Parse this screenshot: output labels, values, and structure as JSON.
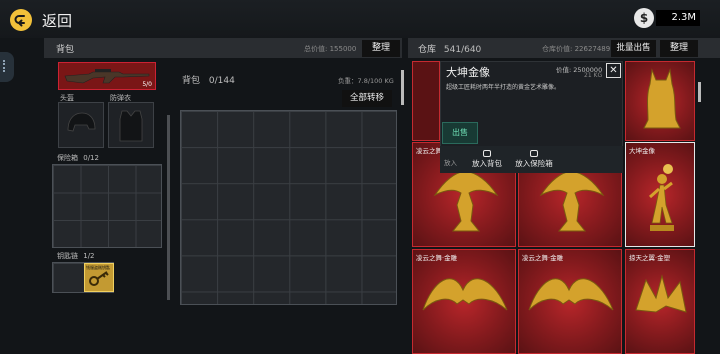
{
  "top": {
    "back_label": "返回",
    "currency": "2.3M",
    "coin_glyph": "$"
  },
  "backpack_panel": {
    "title": "背包",
    "total_value_label": "总价值: 155000",
    "sort_label": "整理",
    "weapon_count": "5/0",
    "helmet_label": "头盔",
    "vest_label": "防弹衣",
    "safe_label": "保险箱",
    "safe_count": "0/12",
    "key_label": "钥匙链",
    "key_count": "1/2",
    "key_item_label": "钱服盗贼钥匙",
    "bag_label": "背包",
    "bag_count": "0/144",
    "load": "负重：7.8/100 KG",
    "transfer_all_label": "全部转移"
  },
  "warehouse_panel": {
    "title": "仓库",
    "capacity": "541/640",
    "value_label": "仓库价值: 22627489",
    "bulk_sell_label": "批量出售",
    "sort_label": "整理",
    "items": [
      {
        "name": "凌云之舞",
        "icon": "golden-eagle-statue-icon"
      },
      {
        "name": "",
        "icon": "golden-eagle-statue-icon"
      },
      {
        "name": "大坤金像",
        "icon": "golden-figure-statue-icon"
      },
      {
        "name": "凌云之舞·金雕",
        "icon": "golden-eagle-statue-icon"
      },
      {
        "name": "凌云之舞·金雕",
        "icon": "golden-eagle-statue-icon"
      },
      {
        "name": "掠天之翼·金塑",
        "icon": "golden-dragon-statue-icon"
      },
      {
        "name": "",
        "icon": "golden-cat-statue-icon"
      }
    ]
  },
  "popup": {
    "title": "大坤金像",
    "price": "价值: 2500000",
    "weight": "21 KG",
    "description": "超级工匠耗时两年半打造的黄金艺术雕像。",
    "sell_label": "出售",
    "put_label": "放入",
    "to_bag_label": "放入背包",
    "to_safe_label": "放入保险箱"
  },
  "colors": {
    "accent_gold": "#f2c13a",
    "item_red": "#b8262a",
    "sell_green": "#6fe0b6"
  }
}
